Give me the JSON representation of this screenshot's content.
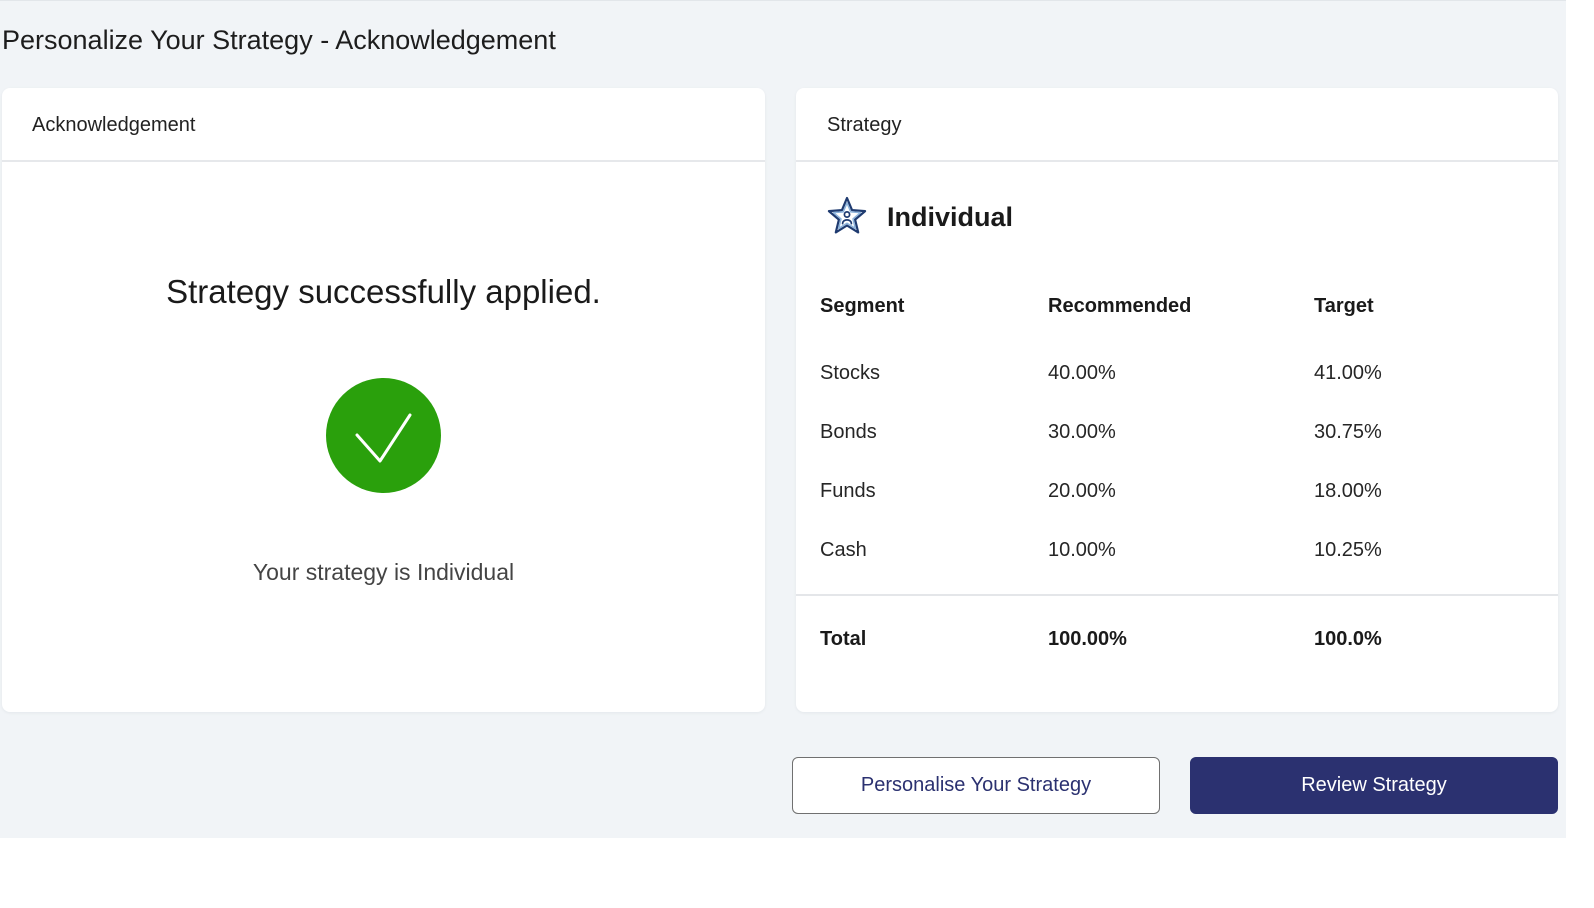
{
  "page": {
    "title": "Personalize Your Strategy - Acknowledgement"
  },
  "acknowledgement_card": {
    "header": "Acknowledgement",
    "message": "Strategy successfully applied.",
    "icon": "check-circle-icon",
    "subtext": "Your strategy is Individual"
  },
  "strategy_card": {
    "header": "Strategy",
    "icon": "star-person-icon",
    "strategy_name": "Individual",
    "table": {
      "columns": [
        "Segment",
        "Recommended",
        "Target"
      ],
      "rows": [
        {
          "segment": "Stocks",
          "recommended": "40.00%",
          "target": "41.00%"
        },
        {
          "segment": "Bonds",
          "recommended": "30.00%",
          "target": "30.75%"
        },
        {
          "segment": "Funds",
          "recommended": "20.00%",
          "target": "18.00%"
        },
        {
          "segment": "Cash",
          "recommended": "10.00%",
          "target": "10.25%"
        }
      ],
      "total": {
        "label": "Total",
        "recommended": "100.00%",
        "target": "100.0%"
      }
    }
  },
  "actions": {
    "personalise_label": "Personalise Your Strategy",
    "review_label": "Review Strategy"
  },
  "colors": {
    "background": "#f1f4f7",
    "accent": "#2b3170",
    "success": "#2aa00c"
  }
}
